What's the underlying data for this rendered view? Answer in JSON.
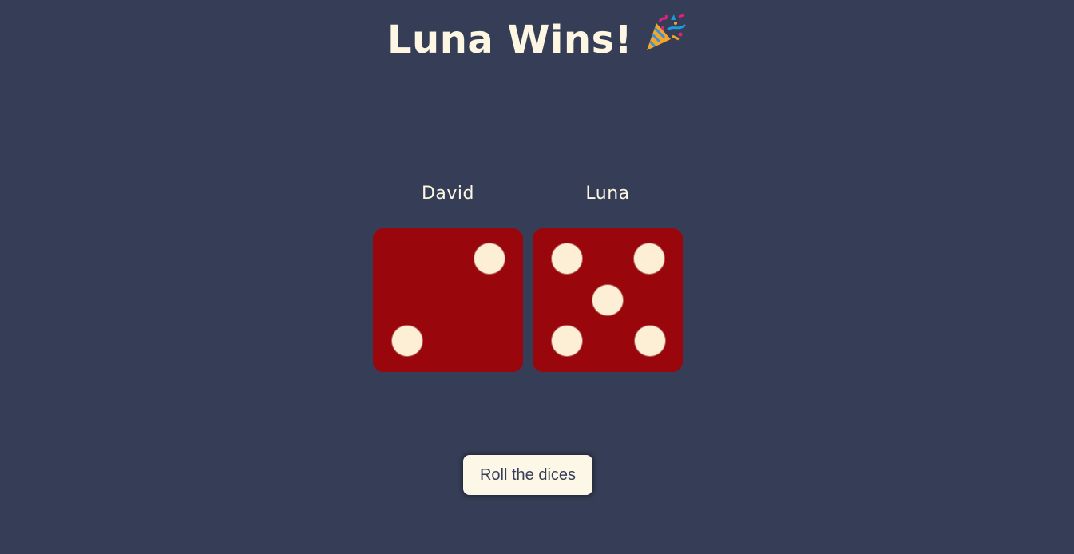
{
  "header": {
    "title": "Luna Wins!",
    "emoji_icon": "party-popper-icon"
  },
  "players": [
    {
      "name": "David",
      "die_value": 2
    },
    {
      "name": "Luna",
      "die_value": 5
    }
  ],
  "colors": {
    "background": "#353e56",
    "die": "#99070c",
    "pip": "#fcefd6",
    "text": "#fdf6e3",
    "button_bg": "#fdf7e7"
  },
  "actions": {
    "roll_label": "Roll the dices"
  }
}
